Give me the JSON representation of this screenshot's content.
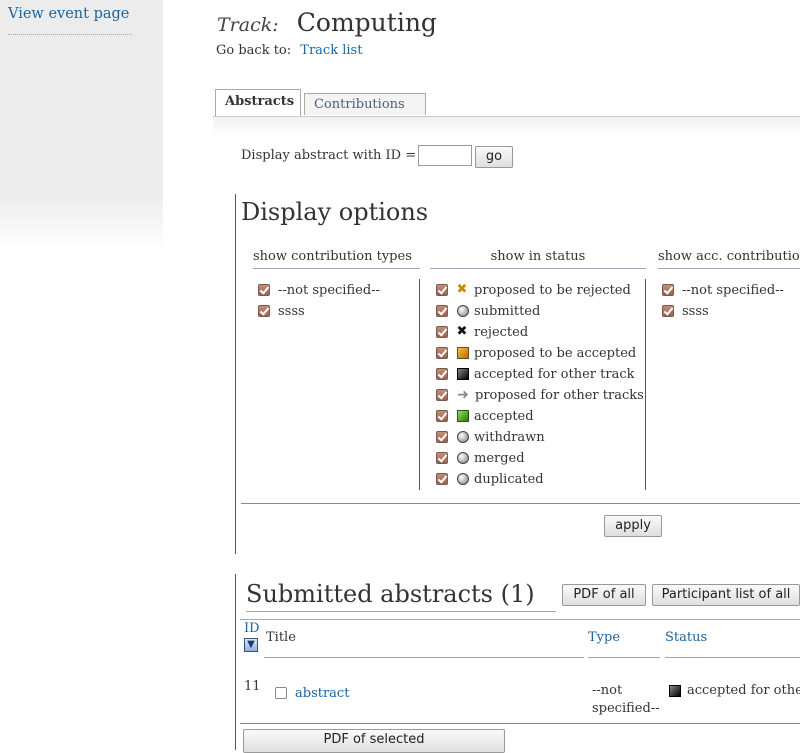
{
  "sidebar": {
    "view_event_page": "View event page"
  },
  "header": {
    "track_label": "Track:",
    "track_name": "Computing",
    "go_back_label": "Go back to:",
    "track_list_link": "Track list"
  },
  "tabs": [
    {
      "label": "Abstracts",
      "active": true
    },
    {
      "label": "Contributions",
      "active": false
    }
  ],
  "id_search": {
    "label": "Display abstract with ID =",
    "value": "",
    "button": "go"
  },
  "display_options": {
    "title": "Display options",
    "columns": {
      "contrib_types": {
        "header": "show contribution types",
        "items": [
          "--not specified--",
          "ssss"
        ]
      },
      "status": {
        "header": "show in status",
        "items": [
          {
            "label": "proposed to be rejected",
            "icon": "orange-x-icon"
          },
          {
            "label": "submitted",
            "icon": "circle-icon"
          },
          {
            "label": "rejected",
            "icon": "black-x-icon"
          },
          {
            "label": "proposed to be accepted",
            "icon": "orange-square-icon"
          },
          {
            "label": "accepted for other track",
            "icon": "black-square-icon"
          },
          {
            "label": "proposed for other tracks",
            "icon": "arrow-icon"
          },
          {
            "label": "accepted",
            "icon": "green-square-icon"
          },
          {
            "label": "withdrawn",
            "icon": "circle-icon"
          },
          {
            "label": "merged",
            "icon": "circle-icon"
          },
          {
            "label": "duplicated",
            "icon": "circle-icon"
          }
        ]
      },
      "acc_contrib": {
        "header": "show acc. contribution",
        "items": [
          "--not specified--",
          "ssss"
        ]
      }
    },
    "apply_button": "apply"
  },
  "submitted": {
    "title": "Submitted abstracts (1)",
    "pdf_all_button": "PDF of all",
    "participant_list_button": "Participant list of all",
    "columns": {
      "id": "ID",
      "title": "Title",
      "type": "Type",
      "status": "Status"
    },
    "rows": [
      {
        "id": "11",
        "title": "abstract",
        "type_line1": "--not",
        "type_line2": "specified--",
        "status": "accepted for other track"
      }
    ],
    "pdf_selected_button": "PDF of selected"
  },
  "colors": {
    "link": "#1a64a0",
    "checkbox": "#9a6252",
    "sidebar_bg": "#ececec"
  }
}
